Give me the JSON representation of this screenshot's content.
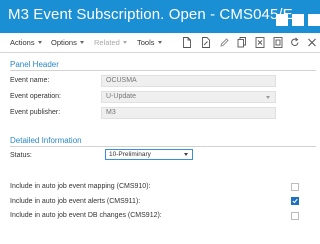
{
  "window": {
    "title": "M3 Event Subscription. Open - CMS045/E"
  },
  "toolbar": {
    "menus": [
      {
        "label": "Actions",
        "enabled": true
      },
      {
        "label": "Options",
        "enabled": true
      },
      {
        "label": "Related",
        "enabled": false
      },
      {
        "label": "Tools",
        "enabled": true
      }
    ],
    "icons": [
      "new-document-icon",
      "edit-document-icon",
      "pencil-icon",
      "copy-icon",
      "delete-icon",
      "display-icon",
      "refresh-icon",
      "close-icon"
    ]
  },
  "panel_header": {
    "title": "Panel Header",
    "fields": [
      {
        "label": "Event name:",
        "value": "OCUSMA"
      },
      {
        "label": "Event operation:",
        "value": "U-Update"
      },
      {
        "label": "Event publisher:",
        "value": "M3"
      }
    ]
  },
  "detailed_information": {
    "title": "Detailed Information",
    "status_label": "Status:",
    "status_value": "10-Preliminary",
    "checkboxes": [
      {
        "label": "Include in auto job event mapping (CMS910):",
        "checked": false
      },
      {
        "label": "Include in auto job event alerts (CMS911):",
        "checked": true
      },
      {
        "label": "Include in auto job event DB changes (CMS912):",
        "checked": false
      }
    ]
  },
  "colors": {
    "titlebar": "#1b8fd3",
    "section_title": "#2a88c8",
    "checkbox_checked": "#1d6fc4"
  }
}
